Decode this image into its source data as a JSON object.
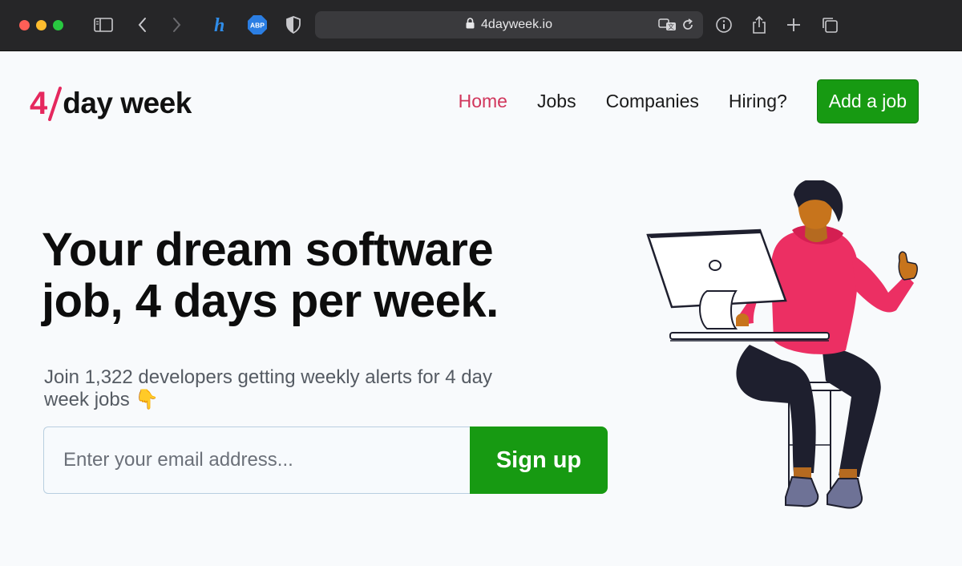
{
  "browser": {
    "url": "4dayweek.io",
    "toolbar_icons": [
      "sidebar-icon",
      "back-icon",
      "forward-icon",
      "honey-extension-icon",
      "adblock-icon",
      "privacy-shield-icon"
    ],
    "extension_abp_label": "ABP",
    "right_icons": [
      "translate-icon",
      "reload-icon",
      "info-icon",
      "share-icon",
      "new-tab-icon",
      "tab-overview-icon"
    ]
  },
  "logo": {
    "four": "4",
    "rest": "day week"
  },
  "nav": {
    "items": [
      {
        "label": "Home",
        "active": true
      },
      {
        "label": "Jobs",
        "active": false
      },
      {
        "label": "Companies",
        "active": false
      },
      {
        "label": "Hiring?",
        "active": false
      }
    ],
    "cta_label": "Add a job"
  },
  "hero": {
    "title_line1": "Your dream software",
    "title_line2": "job, 4 days per week.",
    "subtitle": "Join 1,322 developers getting weekly alerts for 4 day week jobs",
    "subtitle_emoji": "👇"
  },
  "signup": {
    "placeholder": "Enter your email address...",
    "button_label": "Sign up"
  },
  "colors": {
    "brand_pink": "#e5285e",
    "active_nav": "#d1365c",
    "cta_green": "#179a12",
    "hoodie": "#ec2f63",
    "pants": "#1e1f2e"
  }
}
